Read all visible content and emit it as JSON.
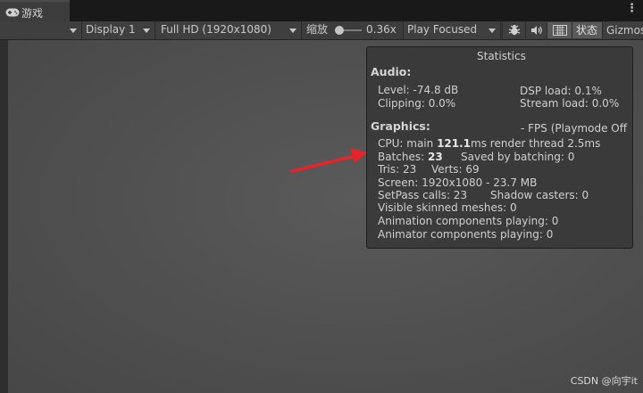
{
  "tab": {
    "label": "游戏"
  },
  "toolbar": {
    "display": "Display 1",
    "resolution": "Full HD (1920x1080)",
    "scale_label": "缩放",
    "scale_value": "0.36x",
    "play_mode": "Play Focused",
    "stats_button": "状态",
    "gizmos_button": "Gizmos"
  },
  "stats": {
    "title": "Statistics",
    "audio": {
      "heading": "Audio:",
      "level": "Level: -74.8 dB",
      "clipping": "Clipping: 0.0%",
      "dsp_load": "DSP load: 0.1%",
      "stream_load": "Stream load: 0.0%"
    },
    "graphics": {
      "heading": "Graphics:",
      "fps": "- FPS (Playmode Off",
      "cpu_prefix": "CPU: main ",
      "cpu_main": "121.1",
      "cpu_suffix": "ms  render thread 2.5ms",
      "batches_prefix": "Batches: ",
      "batches_value": "23",
      "saved_by_batching": "Saved by batching: 0",
      "tris": "Tris: 23",
      "verts": "Verts: 69",
      "screen": "Screen: 1920x1080 - 23.7 MB",
      "setpass": "SetPass calls: 23",
      "shadow_casters": "Shadow casters: 0",
      "skinned_meshes": "Visible skinned meshes: 0",
      "animation_components": "Animation components playing: 0",
      "animator_components": "Animator components playing: 0"
    }
  },
  "watermark": "CSDN @向宇it",
  "colors": {
    "arrow": "#e8232a",
    "panel_bg": "#3a3a3a",
    "viewport_bg": "#525252"
  },
  "icons": [
    "gamepad-icon",
    "menu-dots-icon",
    "bug-icon",
    "speaker-icon",
    "keyboard-icon"
  ]
}
